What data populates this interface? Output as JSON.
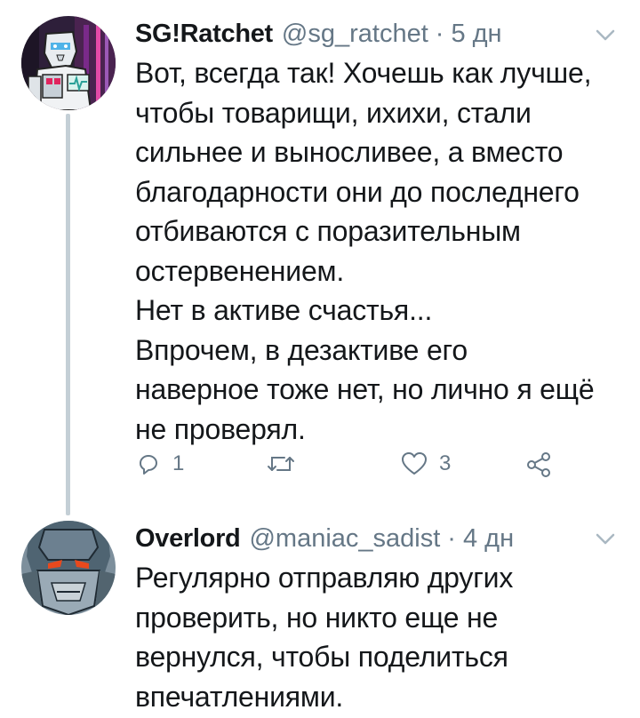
{
  "tweets": [
    {
      "display_name": "SG!Ratchet",
      "handle": "@sg_ratchet",
      "separator": "·",
      "time": "5 дн",
      "lines": [
        "Вот, всегда так! Хочешь как лучше,",
        "чтобы товарищи, ихихи, стали",
        "сильнее и выносливее, а вместо",
        "благодарности они до последнего",
        "отбиваются с поразительным",
        "остервенением.",
        "Нет в активе счастья...",
        "Впрочем, в дезактиве его",
        "наверное тоже нет, но лично я ещё",
        "не проверял."
      ],
      "reply_count": "1",
      "retweet_count": "",
      "like_count": "3",
      "colors": {
        "avatar_bg": "#3b2a48",
        "accent": "#e0245e"
      }
    },
    {
      "display_name": "Overlord",
      "handle": "@maniac_sadist",
      "separator": "·",
      "time": "4 дн",
      "lines": [
        "Регулярно отправляю других",
        "проверить, но никто еще не",
        "вернулся, чтобы поделиться",
        "впечатлениями."
      ],
      "colors": {
        "avatar_bg": "#6a7f8e"
      }
    }
  ],
  "icons": {
    "more": "chevron-down-icon",
    "reply": "reply-icon",
    "retweet": "retweet-icon",
    "like": "heart-icon",
    "share": "share-icon"
  },
  "colors": {
    "text": "#14171a",
    "secondary": "#657786",
    "thread_line": "#c4cfd6",
    "background": "#ffffff"
  }
}
